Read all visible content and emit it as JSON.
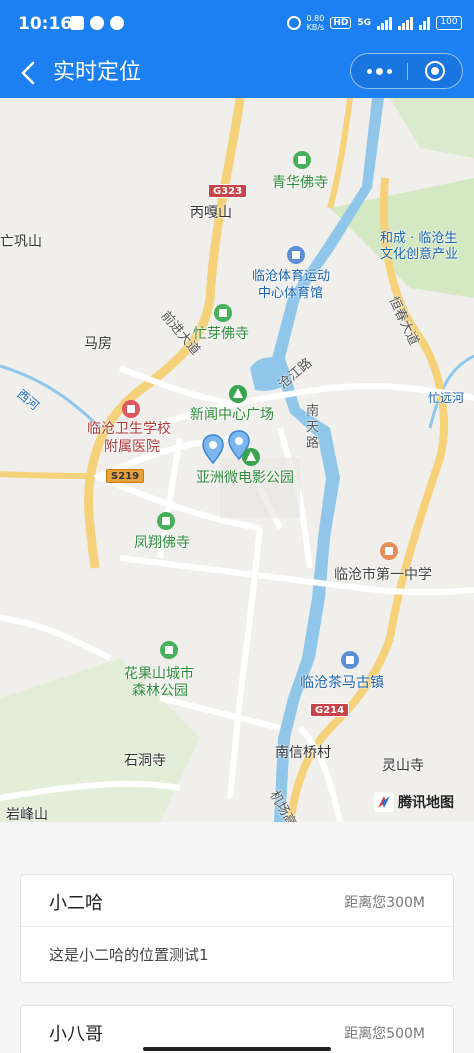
{
  "status_bar": {
    "time": "10:16",
    "speed_value": "0.80",
    "speed_unit": "KB/s",
    "hd": "HD",
    "network": "5G",
    "battery": "100"
  },
  "title_bar": {
    "title": "实时定位"
  },
  "map": {
    "labels": {
      "qinghua": "青华佛寺",
      "bingga": "丙嘎山",
      "gongshan": "亡巩山",
      "hecheng1": "和成 · 临沧生",
      "hecheng2": "文化创意产业",
      "sports1": "临沧体育运动",
      "sports2": "中心体育馆",
      "hengchun": "恒春大道",
      "qianjin": "前进大道",
      "mangya": "忙芽佛寺",
      "mafang": "马房",
      "canjiang": "沧江路",
      "xihe": "西河",
      "xinwen": "新闻中心广场",
      "nantian": "南天路",
      "hospital1": "临沧卫生学校",
      "hospital2": "附属医院",
      "yazhou": "亚洲微电影公园",
      "mangyuan": "忙远河",
      "fengxiang": "凤翔佛寺",
      "school": "临沧市第一中学",
      "huaguo1": "花果山城市",
      "huaguo2": "森林公园",
      "chama": "临沧茶马古镇",
      "shidong": "石洞寺",
      "nanxin": "南信桥村",
      "lingshan": "灵山寺",
      "yanfeng": "岩峰山",
      "jichang": "机场高"
    },
    "shields": {
      "g323": "G323",
      "s219": "S219",
      "g214": "G214"
    },
    "logo": "腾讯地图"
  },
  "list": {
    "items": [
      {
        "name": "小二哈",
        "distance": "距离您300M",
        "desc": "这是小二哈的位置测试1"
      },
      {
        "name": "小八哥",
        "distance": "距离您500M"
      }
    ]
  },
  "colors": {
    "primary": "#1c7ff2",
    "road_major": "#f5d27a",
    "water": "#8fc6ea",
    "park": "#d4e8c4"
  }
}
